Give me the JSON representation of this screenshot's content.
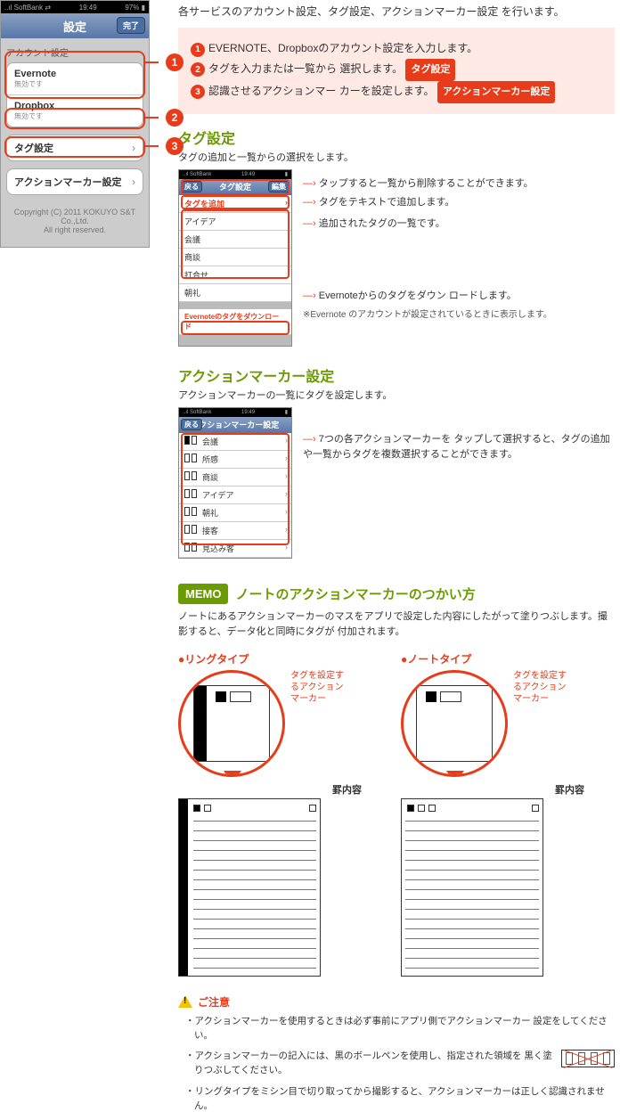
{
  "intro": "各サービスのアカウント設定、タグ設定、アクションマーカー設定 を行います。",
  "phone": {
    "statusbar": {
      "carrier": "..ıl SoftBank ⇄",
      "time": "19:49",
      "battery": "97% ▮"
    },
    "nav": {
      "title": "設定",
      "done": "完了"
    },
    "account_section": "アカウント設定",
    "rows": {
      "evernote": {
        "title": "Evernote",
        "sub": "無効です"
      },
      "dropbox": {
        "title": "Dropbox",
        "sub": "無効です"
      }
    },
    "tag_row": "タグ設定",
    "action_row": "アクションマーカー設定",
    "copyright1": "Copyright (C) 2011 KOKUYO S&T Co.,Ltd.",
    "copyright2": "All right reserved."
  },
  "pinkbox": {
    "l1": "EVERNOTE、Dropboxのアカウント設定を入力します。",
    "l2a": "タグを入力または一覧から 選択します。",
    "l2chip": "タグ設定",
    "l3a": "認識させるアクションマー カーを設定します。",
    "l3chip": "アクションマーカー設定"
  },
  "tagset": {
    "heading": "タグ設定",
    "desc": "タグの追加と一覧からの選択をします。",
    "subnav": {
      "back": "戻る",
      "title": "タグ設定",
      "edit": "編集"
    },
    "addrow": "タグを追加",
    "tags": [
      "アイデア",
      "会議",
      "商談",
      "打合せ",
      "朝礼"
    ],
    "dlrow": "Evernoteのタグをダウンロード",
    "note1": "タップすると一覧から削除することができます。",
    "note2": "タグをテキストで追加します。",
    "note3": "追加されたタグの一覧です。",
    "note4": "Evernoteからのタグをダウン ロードします。",
    "note4b": "※Evernote のアカウントが設定されているときに表示します。"
  },
  "actset": {
    "heading": "アクションマーカー設定",
    "desc": "アクションマーカーの一覧にタグを設定します。",
    "subnav": {
      "back": "戻る",
      "title": "アクションマーカー設定"
    },
    "items": [
      "会議",
      "所感",
      "商談",
      "アイデア",
      "朝礼",
      "接客",
      "見込み客"
    ],
    "note": "7つの各アクションマーカーを タップして選択すると、タグの追加や一覧からタグを複数選択することができます。"
  },
  "memo": {
    "badge": "MEMO",
    "title": "ノートのアクションマーカーのつかい方",
    "desc": "ノートにあるアクションマーカーのマスをアプリで設定した内容にしたがって塗りつぶします。撮影すると、データ化と同時にタグが 付加されます。",
    "ring_title": "●リングタイプ",
    "note_title": "●ノートタイプ",
    "ann": "タグを設定するアクションマーカー",
    "sheet_label": "罫内容"
  },
  "caution": {
    "title": "ご注意",
    "b1": "・アクションマーカーを使用するときは必ず事前にアプリ側でアクションマーカー 設定をしてください。",
    "b2": "・アクションマーカーの記入には、黒のボールペンを使用し、指定された領域を 黒く塗りつぶしてください。",
    "b3": "・リングタイプをミシン目で切り取ってから撮影すると、アクションマーカーは正しく認識されません。"
  }
}
